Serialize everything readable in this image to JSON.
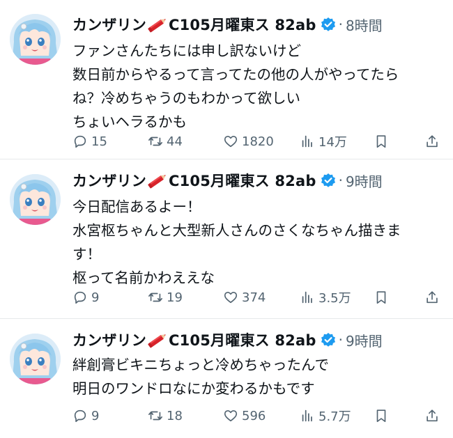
{
  "tweets": [
    {
      "name": "カンザリン",
      "name_suffix": "C105月曜東ス 82ab",
      "time": "8時間",
      "lines": [
        "ファンさんたちには申し訳ないけど",
        "数日前からやるって言ってたの他の人がやってたら",
        "ね？冷めちゃうのもわかって欲しい",
        "ちょいヘラるかも"
      ],
      "replies": "15",
      "retweets": "44",
      "likes": "1820",
      "views": "14万"
    },
    {
      "name": "カンザリン",
      "name_suffix": "C105月曜東ス 82ab",
      "time": "9時間",
      "lines": [
        "今日配信あるよー！",
        "水宮枢ちゃんと大型新人さんのさくなちゃん描きま",
        "す！",
        "枢って名前かわええな"
      ],
      "replies": "9",
      "retweets": "19",
      "likes": "374",
      "views": "3.5万"
    },
    {
      "name": "カンザリン",
      "name_suffix": "C105月曜東ス 82ab",
      "time": "9時間",
      "lines": [
        "絆創膏ビキニちょっと冷めちゃったんで",
        "明日のワンドロなにか変わるかもです"
      ],
      "replies": "9",
      "retweets": "18",
      "likes": "596",
      "views": "5.7万"
    }
  ],
  "colors": {
    "text": "#0f1419",
    "secondary": "#536471",
    "verified": "#1d9bf0",
    "divider": "#e6e9eb"
  },
  "icons": [
    "avatar",
    "pencil-emoji-icon",
    "verified-badge-icon",
    "reply-icon",
    "retweet-icon",
    "like-icon",
    "views-icon",
    "bookmark-icon",
    "share-icon"
  ]
}
